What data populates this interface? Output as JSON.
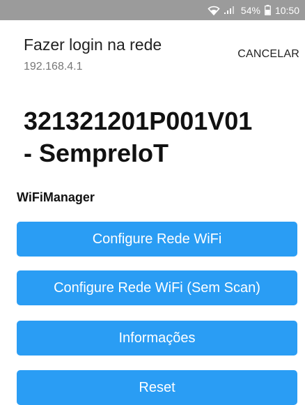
{
  "status_bar": {
    "signal_label": ".ıll",
    "battery_level": "54%",
    "time": "10:50",
    "icons": [
      "wifi-icon",
      "signal-icon",
      "battery-icon"
    ]
  },
  "header": {
    "title": "Fazer login na rede",
    "subtitle": "192.168.4.1",
    "cancel_label": "CANCELAR"
  },
  "page": {
    "title_line1": "321321201P001V01",
    "title_line2": "-  SempreIoT",
    "section_label": "WiFiManager"
  },
  "buttons": [
    {
      "label": "Configure Rede WiFi"
    },
    {
      "label": "Configure Rede WiFi (Sem Scan)"
    },
    {
      "label": "Informações"
    },
    {
      "label": "Reset"
    }
  ],
  "colors": {
    "status_bar_bg": "#9b9b9b",
    "button_bg": "#2a9df4",
    "button_text": "#ffffff"
  }
}
